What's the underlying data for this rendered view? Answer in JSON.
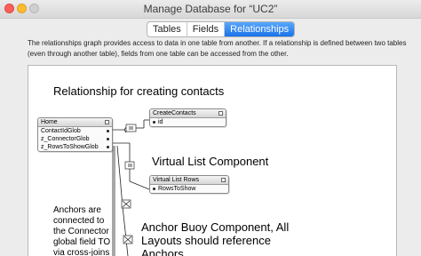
{
  "window": {
    "title": "Manage Database for “UC2”"
  },
  "tabs": [
    {
      "label": "Tables",
      "active": false
    },
    {
      "label": "Fields",
      "active": false
    },
    {
      "label": "Relationships",
      "active": true
    }
  ],
  "description": "The relationships graph provides access to data in one table from another. If a relationship is defined between two tables (even through another table), fields from one table can be accessed from the other.",
  "notes": {
    "contacts_heading": "Relationship for creating contacts",
    "virtual_list": "Virtual List Component",
    "anchors": "Anchors are connected to the Connector global field TO via cross-joins",
    "anchor_buoy": "Anchor Buoy Component, All Layouts should reference Anchors"
  },
  "table_occurrences": [
    {
      "name": "Home",
      "fields": [
        "ContactIdGlob",
        "z_ConnectorGlob",
        "z_RowsToShowGlob"
      ]
    },
    {
      "name": "CreateContacts",
      "fields": [
        "id"
      ]
    },
    {
      "name": "Virtual List Rows",
      "fields": [
        "RowsToShow"
      ]
    }
  ],
  "colors": {
    "active_tab": "#1a73e8",
    "canvas": "#ffffff",
    "chrome": "#ececec"
  }
}
